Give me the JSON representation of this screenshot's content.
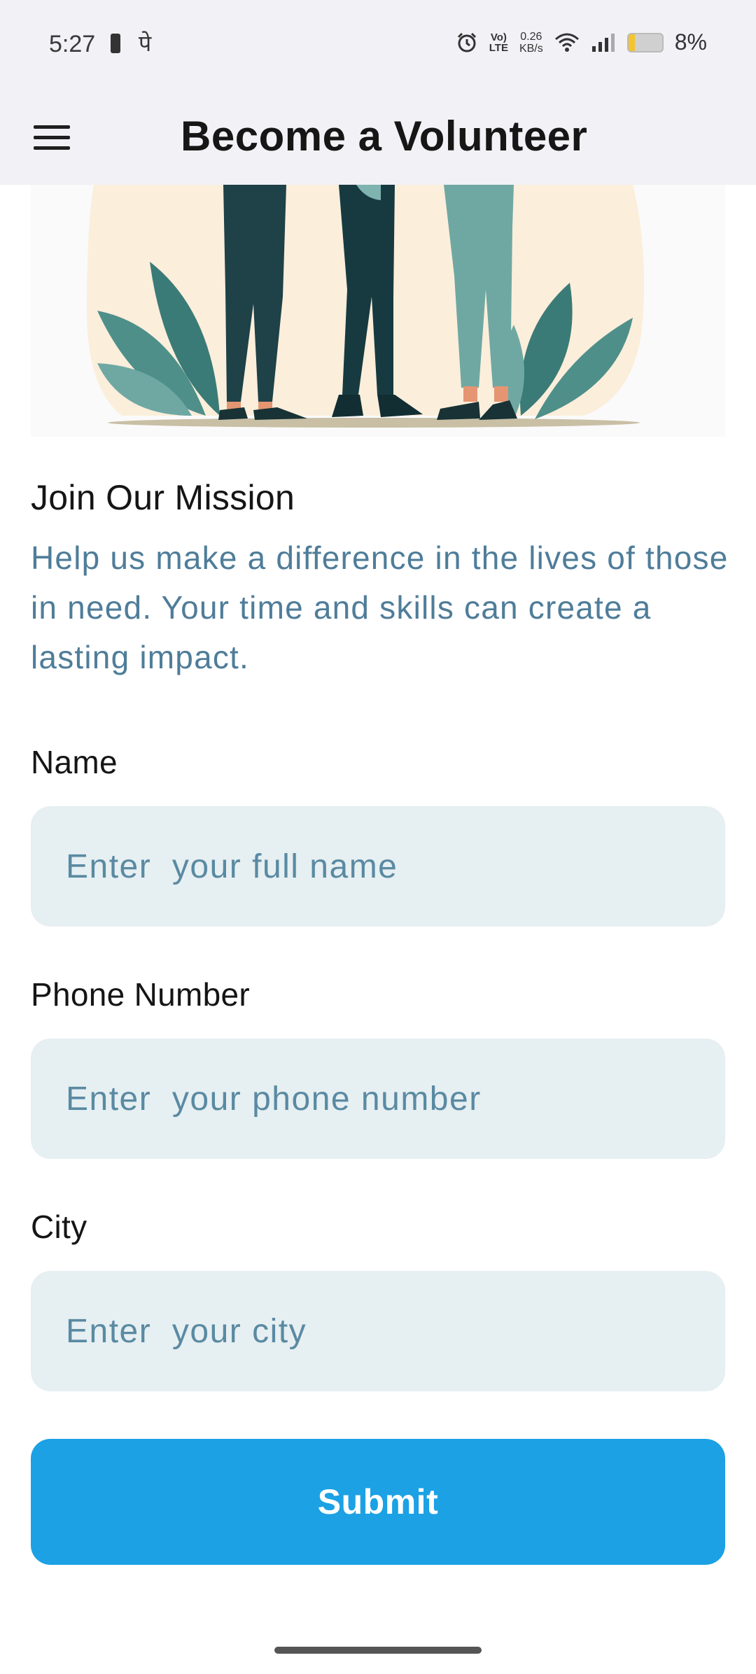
{
  "status_bar": {
    "time": "5:27",
    "left_glyph": "पे",
    "network": {
      "line1": "Vo)",
      "line2": "LTE"
    },
    "speed": {
      "value": "0.26",
      "unit": "KB/s"
    },
    "battery_percent": "8%",
    "battery_level": 0.08,
    "icons": [
      "battery-small-icon",
      "alarm-icon",
      "wifi-icon",
      "signal-icon",
      "battery-icon"
    ]
  },
  "app_bar": {
    "title": "Become a Volunteer",
    "menu_icon": "hamburger-menu-icon"
  },
  "mission": {
    "title": "Join Our Mission",
    "text": "Help us make a difference in the lives of those in need. Your time and skills can create a lasting impact."
  },
  "form": {
    "name": {
      "label": "Name",
      "placeholder": "Enter  your full name"
    },
    "phone": {
      "label": "Phone Number",
      "placeholder": "Enter  your phone number"
    },
    "city": {
      "label": "City",
      "placeholder": "Enter  your city"
    },
    "submit_label": "Submit"
  },
  "colors": {
    "accent": "#1ca1e4",
    "input_bg": "#e6eff1",
    "body_text_blue": "#4f7d99",
    "app_bar_bg": "#f1f1f6"
  }
}
